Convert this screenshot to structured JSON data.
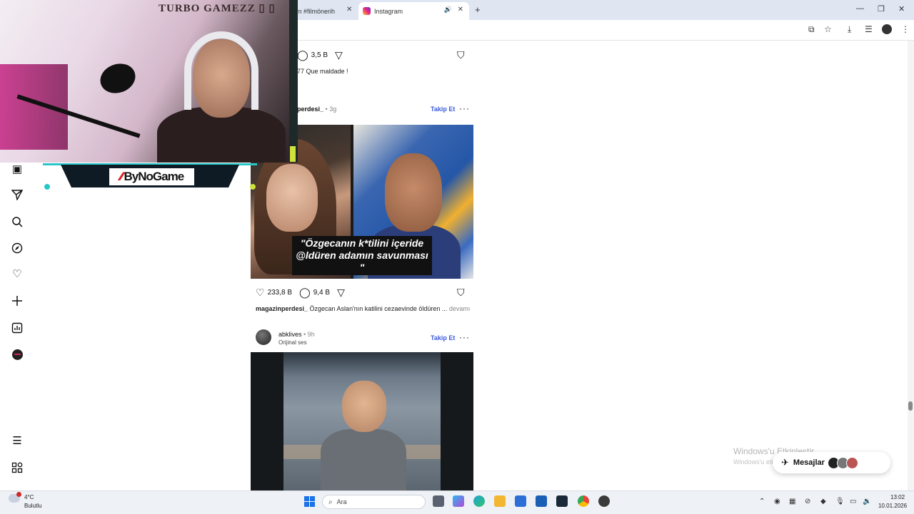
{
  "browser": {
    "tab_inactive_label": "m #filmönerih",
    "tab_active_label": "Instagram",
    "close_glyph": "✕",
    "new_tab_glyph": "+"
  },
  "cam": {
    "title": "TURBO GAMEZZ ▯ ▯",
    "sponsor_logo": "ByNoGame"
  },
  "posts": [
    {
      "comments": "3,5 B",
      "caption_text": "77 Que maldade !"
    },
    {
      "username": "perdesi_",
      "time": "• 3g",
      "follow_label": "Takip Et",
      "overlay_text": "\"Özgecanın k*tilini içeride @ldüren adamın savunması \"",
      "likes": "233,8 B",
      "comments": "9,4 B",
      "caption_user": "magazinperdesi_",
      "caption_text": " Özgecan Aslan'nın katilini cezaevinde öldüren ...",
      "caption_more": " devamı"
    },
    {
      "username": "abklives",
      "time": "• 9h",
      "audio": "Orijinal ses",
      "follow_label": "Takip Et"
    }
  ],
  "messages": {
    "label": "Mesajlar",
    "watermark_title": "Windows'u Etkinleştir",
    "watermark_sub": "Windows'u etkinleştirmek için Ayarlar'a gidin."
  },
  "taskbar": {
    "weather_temp": "4°C",
    "weather_desc": "Bulutlu",
    "weather_badge": "5",
    "search_placeholder": "Ara",
    "time": "13:02",
    "date": "10.01.2026"
  },
  "colors": {
    "follow_link": "#3b5bdb",
    "windows_accent": "#1a73e8",
    "overlay_cyan": "#27c7c9",
    "overlay_lime": "#cde23a"
  }
}
